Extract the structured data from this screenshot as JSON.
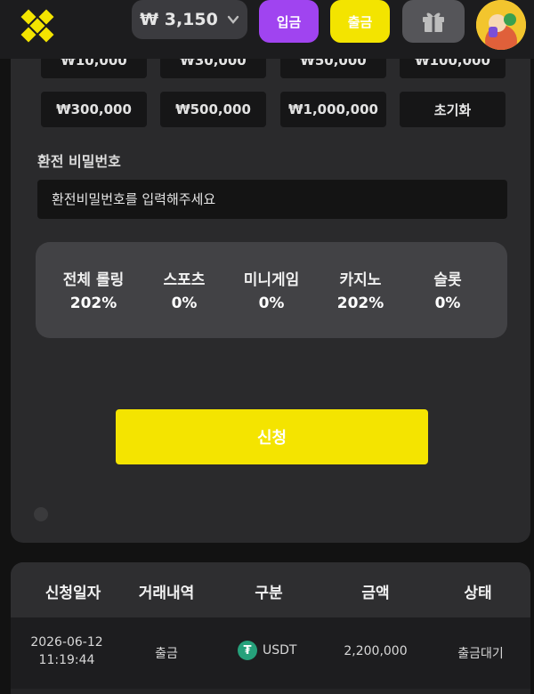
{
  "header": {
    "balance": "₩ 3,150",
    "deposit_label": "입금",
    "withdraw_label": "출금",
    "colors": {
      "deposit": "#a044f0",
      "withdraw": "#f3e400",
      "accent_yellow": "#f3e400"
    }
  },
  "amounts": {
    "row1": [
      "₩10,000",
      "₩30,000",
      "₩50,000",
      "₩100,000"
    ],
    "row2": [
      "₩300,000",
      "₩500,000",
      "₩1,000,000"
    ],
    "reset_label": "초기화"
  },
  "password": {
    "label": "환전 비밀번호",
    "placeholder": "환전비밀번호를 입력해주세요"
  },
  "rolling": [
    {
      "label": "전체 롤링",
      "value": "202%"
    },
    {
      "label": "스포츠",
      "value": "0%"
    },
    {
      "label": "미니게임",
      "value": "0%"
    },
    {
      "label": "카지노",
      "value": "202%"
    },
    {
      "label": "슬롯",
      "value": "0%"
    }
  ],
  "apply_label": "신청",
  "history": {
    "columns": [
      "신청일자",
      "거래내역",
      "구분",
      "금액",
      "상태"
    ],
    "rows": [
      {
        "date": "2026-06-12",
        "time": "11:19:44",
        "type": "출금",
        "currency": "USDT",
        "amount": "2,200,000",
        "status": "출금대기"
      }
    ]
  },
  "icons": [
    "logo-icon",
    "chevron-down-icon",
    "gift-icon",
    "avatar-icon",
    "tether-icon"
  ]
}
